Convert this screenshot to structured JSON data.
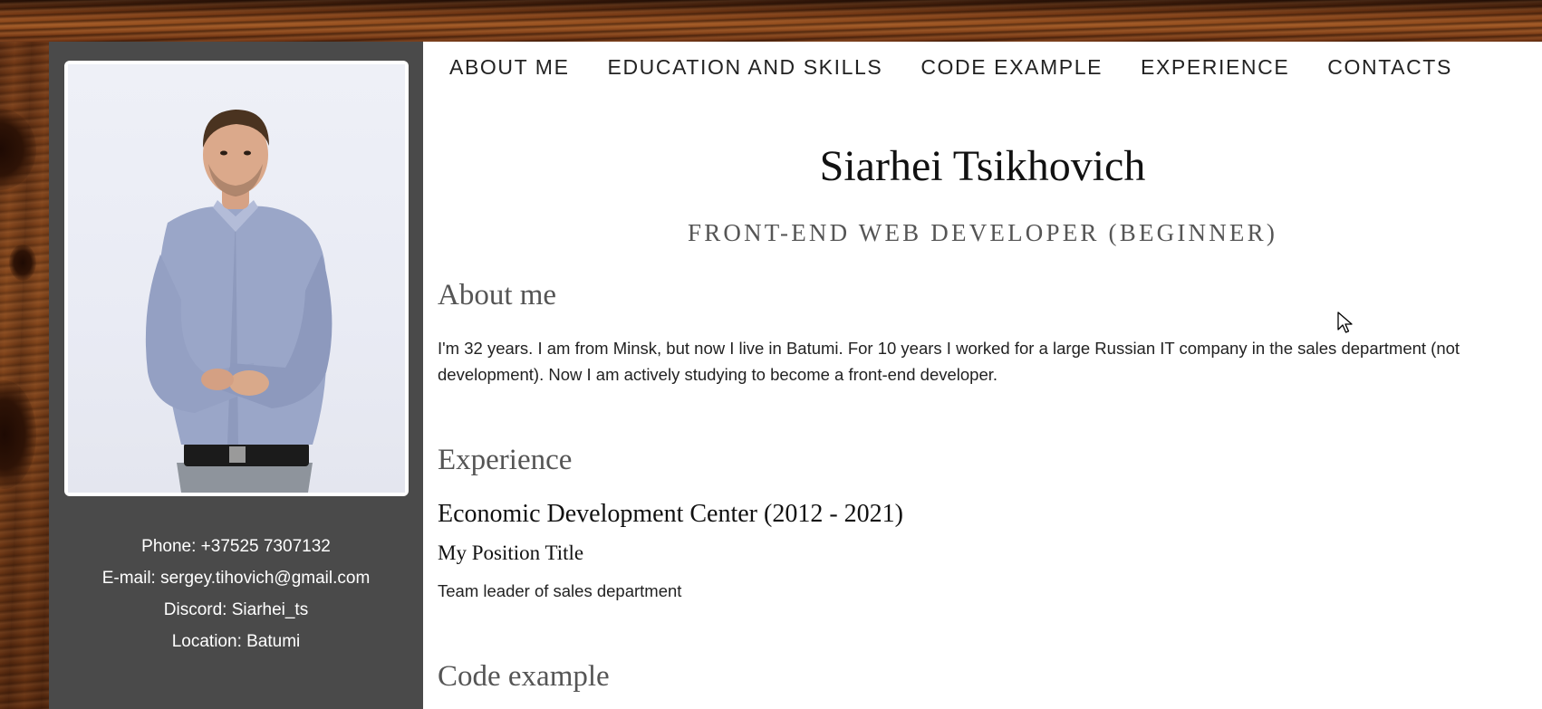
{
  "nav": {
    "items": [
      {
        "label": "ABOUT ME"
      },
      {
        "label": "EDUCATION AND SKILLS"
      },
      {
        "label": "CODE EXAMPLE"
      },
      {
        "label": "EXPERIENCE"
      },
      {
        "label": "CONTACTS"
      }
    ]
  },
  "header": {
    "name": "Siarhei Tsikhovich",
    "role": "FRONT-END WEB DEVELOPER (BEGINNER)"
  },
  "sidebar": {
    "contacts": [
      {
        "text": "Phone: +37525 7307132"
      },
      {
        "text": "E-mail: sergey.tihovich@gmail.com"
      },
      {
        "text": "Discord: Siarhei_ts"
      },
      {
        "text": "Location: Batumi"
      }
    ]
  },
  "about": {
    "heading": "About me",
    "text": "I'm 32 years. I am from Minsk, but now I live in Batumi. For 10 years I worked for a large Russian IT company in the sales department (not development). Now I am actively studying to become a front-end developer."
  },
  "experience": {
    "heading": "Experience",
    "company": "Economic Development Center (2012 - 2021)",
    "position_title": "My Position Title",
    "description": "Team leader of sales department"
  },
  "code": {
    "heading": "Code example"
  },
  "colors": {
    "sidebar_bg": "#4a4a4a",
    "main_bg": "#ffffff",
    "heading": "#555555"
  },
  "icons": {
    "cursor": "mouse-pointer-icon"
  }
}
